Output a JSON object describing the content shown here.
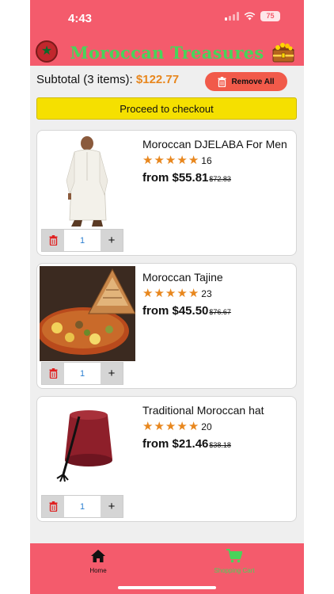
{
  "status_bar": {
    "time": "4:43",
    "battery": "75"
  },
  "header": {
    "title": "Moroccan Treasures",
    "title_color": "#49d35a",
    "bar_color": "#f45b6c",
    "left_icon": "morocco-flag-icon",
    "right_icon": "treasure-chest-icon"
  },
  "cart": {
    "subtotal_label": "Subtotal (3 items): ",
    "subtotal_amount": "$122.77",
    "remove_all_label": "Remove All",
    "checkout_label": "Proceed to checkout",
    "accent_color": "#e8871e"
  },
  "items": [
    {
      "title": "Moroccan DJELABA For Men",
      "rating": 5,
      "rating_count": "16",
      "price": "from $55.81",
      "old_price": "$72.83",
      "quantity": "1",
      "image": "white-djellaba-robe"
    },
    {
      "title": "Moroccan Tajine",
      "rating": 5,
      "rating_count": "23",
      "price": "from $45.50",
      "old_price": "$76.67",
      "quantity": "1",
      "image": "tajine-dish"
    },
    {
      "title": "Traditional Moroccan hat",
      "rating": 5,
      "rating_count": "20",
      "price": "from $21.46",
      "old_price": "$38.18",
      "quantity": "1",
      "image": "red-fez-hat"
    }
  ],
  "tabbar": {
    "home_label": "Home",
    "cart_label": "Shopping Cart",
    "active_color": "#49d35a"
  }
}
